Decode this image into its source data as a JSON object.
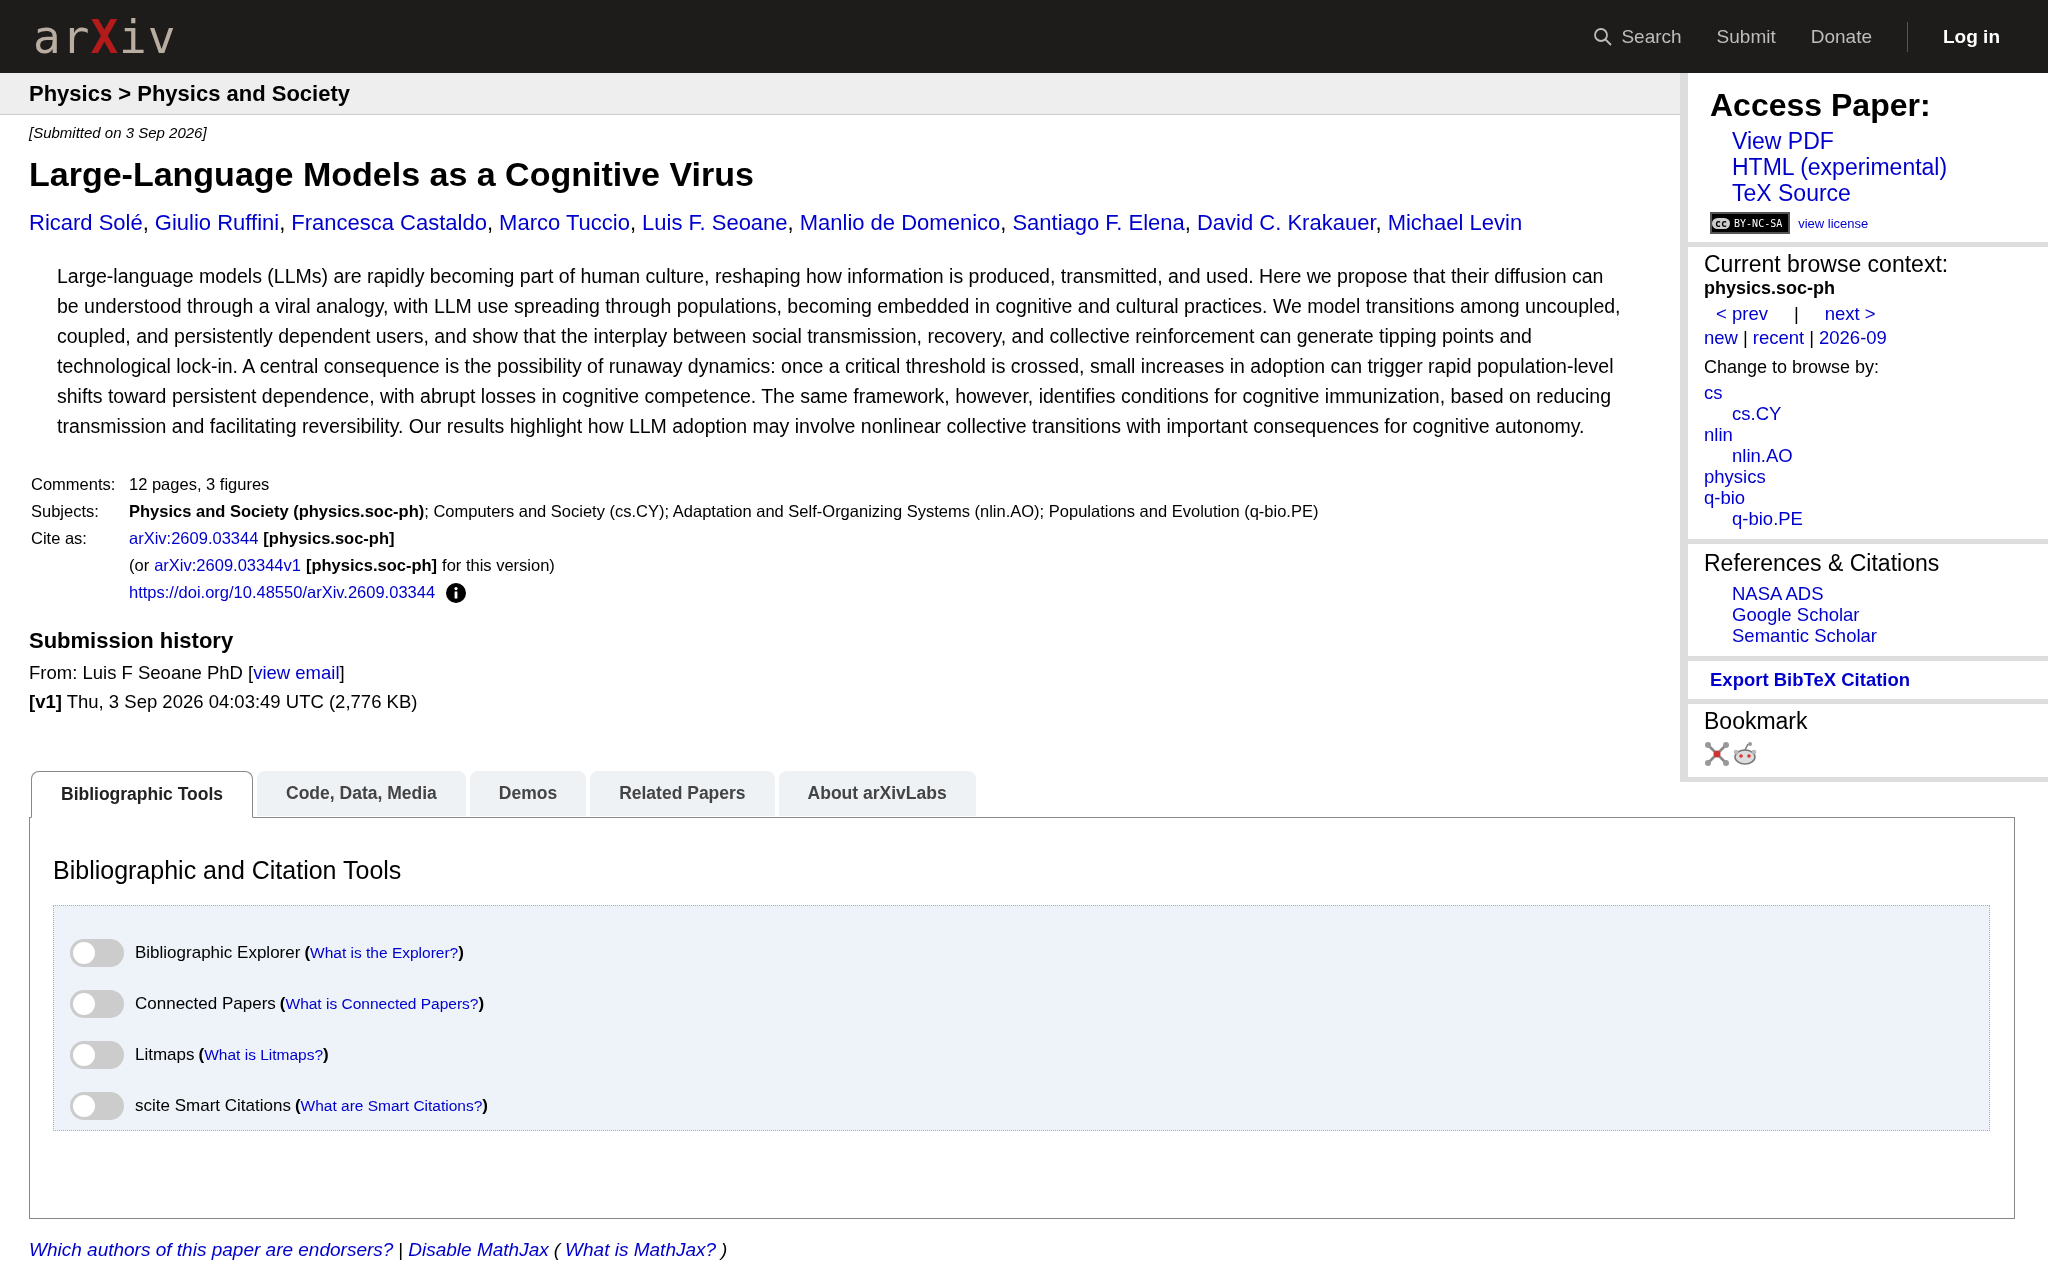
{
  "header": {
    "logo": [
      {
        "t": "ar",
        "kind": "plain"
      },
      {
        "t": "X",
        "kind": "mark"
      },
      {
        "t": "iv",
        "kind": "plain"
      }
    ],
    "nav": [
      {
        "label": "Search",
        "kind": "search"
      },
      {
        "label": "Submit",
        "kind": "link"
      },
      {
        "label": "Donate",
        "kind": "link"
      },
      {
        "label": "Log in",
        "kind": "login"
      }
    ]
  },
  "breadcrumb": "Physics > Physics and Society",
  "paper": {
    "submitted": "[Submitted on 3 Sep 2026]",
    "title": "Large-Language Models as a Cognitive Virus",
    "author_separator": ",",
    "authors": [
      "Ricard Solé",
      "Giulio Ruffini",
      "Francesca Castaldo",
      "Marco Tuccio",
      "Luis F. Seoane",
      "Manlio de Domenico",
      "Santiago F. Elena",
      "David C. Krakauer",
      "Michael Levin"
    ],
    "abstract": "Large-language models (LLMs) are rapidly becoming part of human culture, reshaping how information is produced, transmitted, and used. Here we propose that their diffusion can be understood through a viral analogy, with LLM use spreading through populations, becoming embedded in cognitive and cultural practices. We model transitions among uncoupled, coupled, and persistently dependent users, and show that the interplay between social transmission, recovery, and collective reinforcement can generate tipping points and technological lock-in. A central consequence is the possibility of runaway dynamics: once a critical threshold is crossed, small increases in adoption can trigger rapid population-level shifts toward persistent dependence, with abrupt losses in cognitive competence. The same framework, however, identifies conditions for cognitive immunization, based on reducing transmission and facilitating reversibility. Our results highlight how LLM adoption may involve nonlinear collective transitions with important consequences for cognitive autonomy.",
    "metadata": [
      {
        "label": "Comments:",
        "lines": [
          [
            {
              "t": "12 pages, 3 figures",
              "kind": "text"
            }
          ]
        ]
      },
      {
        "label": "Subjects:",
        "lines": [
          [
            {
              "t": "**Physics and Society (physics.soc-ph)**; Computers and Society (cs.CY); Adaptation and Self-Organizing Systems (nlin.AO); Populations and Evolution (q-bio.PE)",
              "kind": "text"
            }
          ]
        ]
      },
      {
        "label": "Cite as:",
        "lines": [
          [
            {
              "t": "arXiv:2609.03344",
              "kind": "link"
            },
            {
              "t": "[physics.soc-ph]",
              "kind": "bold"
            }
          ],
          [
            {
              "t": "(or",
              "kind": "text"
            },
            {
              "t": "arXiv:2609.03344v1",
              "kind": "link"
            },
            {
              "t": "[physics.soc-ph]",
              "kind": "bold"
            },
            {
              "t": "for this version)",
              "kind": "text"
            }
          ],
          [
            {
              "t": "https://doi.org/10.48550/arXiv.2609.03344",
              "kind": "link"
            },
            {
              "kind": "info"
            }
          ]
        ]
      }
    ],
    "history": {
      "heading": "Submission history",
      "from": [
        {
          "t": "From: Luis F Seoane PhD [",
          "kind": "text"
        },
        {
          "t": "view email",
          "kind": "link"
        },
        {
          "t": "]",
          "kind": "text"
        }
      ],
      "versions": [
        "**[v1]** Thu, 3 Sep 2026 04:03:49 UTC (2,776 KB)"
      ]
    }
  },
  "tabs": [
    {
      "label": "Bibliographic Tools",
      "selected": true
    },
    {
      "label": "Code, Data, Media",
      "selected": false
    },
    {
      "label": "Demos",
      "selected": false
    },
    {
      "label": "Related Papers",
      "selected": false
    },
    {
      "label": "About arXivLabs",
      "selected": false
    }
  ],
  "tools": {
    "heading": "Bibliographic and Citation Tools",
    "paren_open": "(",
    "paren_close": ")",
    "items": [
      {
        "label": "Bibliographic Explorer",
        "link": "What is the Explorer?",
        "on": false
      },
      {
        "label": "Connected Papers",
        "link": "What is Connected Papers?",
        "on": false
      },
      {
        "label": "Litmaps",
        "link": "What is Litmaps?",
        "on": false
      },
      {
        "label": "scite Smart Citations",
        "link": "What are Smart Citations?",
        "on": false
      }
    ]
  },
  "footer": [
    {
      "t": "Which authors of this paper are endorsers?",
      "kind": "link"
    },
    {
      "t": "|",
      "kind": "text"
    },
    {
      "t": "Disable MathJax",
      "kind": "link"
    },
    {
      "t": "(",
      "kind": "text"
    },
    {
      "t": "What is MathJax?",
      "kind": "link"
    },
    {
      "t": ")",
      "kind": "text"
    }
  ],
  "sidebar": {
    "access": {
      "heading": "Access Paper:",
      "links": [
        "View PDF",
        "HTML (experimental)",
        "TeX Source"
      ],
      "badge": {
        "symbol": "cc",
        "terms": "BY-NC-SA"
      },
      "license_link": "view license"
    },
    "browse": {
      "heading": "Current browse context:",
      "context": "physics.soc-ph",
      "prev": "< prev",
      "nav_separator": "|",
      "next": "next >",
      "lists": [
        "new",
        "recent",
        "2026-09"
      ],
      "change_label": "Change to browse by:",
      "categories": [
        {
          "name": "cs",
          "children": [
            {
              "name": "cs.CY"
            }
          ]
        },
        {
          "name": "nlin",
          "children": [
            {
              "name": "nlin.AO"
            }
          ]
        },
        {
          "name": "physics"
        },
        {
          "name": "q-bio",
          "children": [
            {
              "name": "q-bio.PE"
            }
          ]
        }
      ]
    },
    "references": {
      "heading": "References & Citations",
      "links": [
        "NASA ADS",
        "Google Scholar",
        "Semantic Scholar"
      ]
    },
    "export": "Export BibTeX Citation",
    "bookmark": {
      "heading": "Bookmark",
      "icons": [
        {
          "kind": "network"
        },
        {
          "kind": "alien"
        }
      ]
    }
  }
}
